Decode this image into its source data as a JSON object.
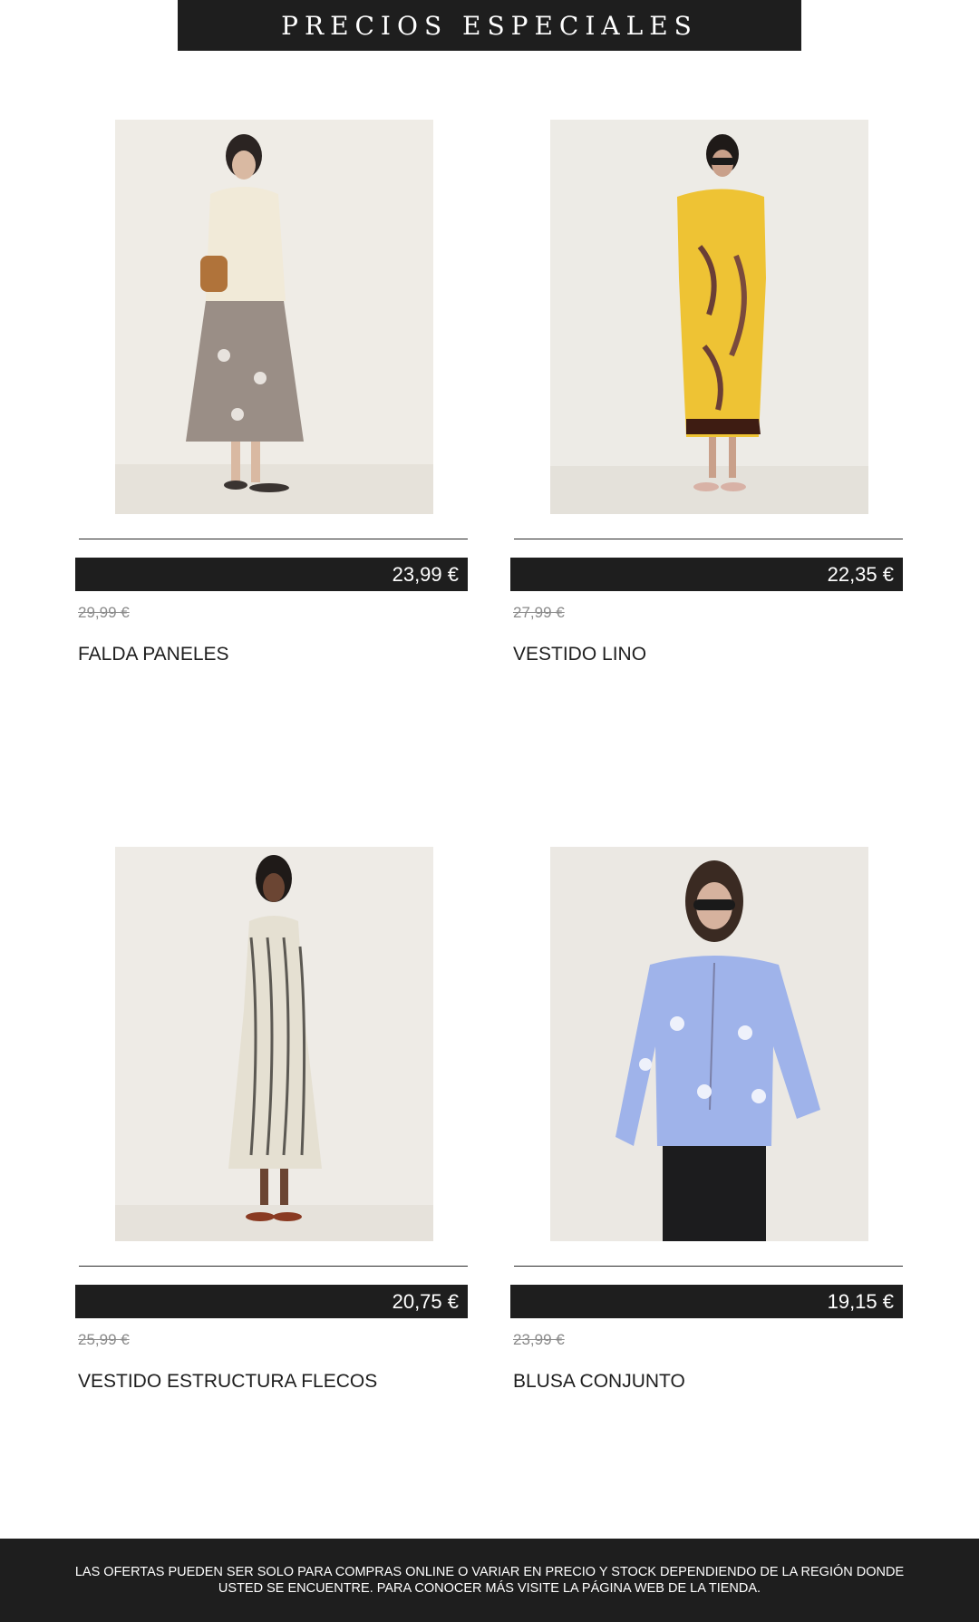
{
  "header": {
    "title": "PRECIOS ESPECIALES"
  },
  "products": [
    {
      "price": "23,99 €",
      "old_price": "29,99 €",
      "name": "FALDA PANELES"
    },
    {
      "price": "22,35 €",
      "old_price": "27,99 €",
      "name": "VESTIDO LINO"
    },
    {
      "price": "20,75 €",
      "old_price": "25,99 €",
      "name": "VESTIDO ESTRUCTURA FLECOS"
    },
    {
      "price": "19,15 €",
      "old_price": "23,99 €",
      "name": "BLUSA CONJUNTO"
    }
  ],
  "footer": {
    "disclaimer": "LAS OFERTAS PUEDEN SER SOLO PARA COMPRAS ONLINE O VARIAR EN PRECIO Y STOCK DEPENDIENDO DE LA REGIÓN DONDE USTED SE ENCUENTRE. PARA CONOCER MÁS VISITE LA PÁGINA WEB DE LA TIENDA."
  },
  "colors": {
    "dark": "#1e1e1e",
    "old_price": "#8a8a8a",
    "background": "#ffffff"
  }
}
